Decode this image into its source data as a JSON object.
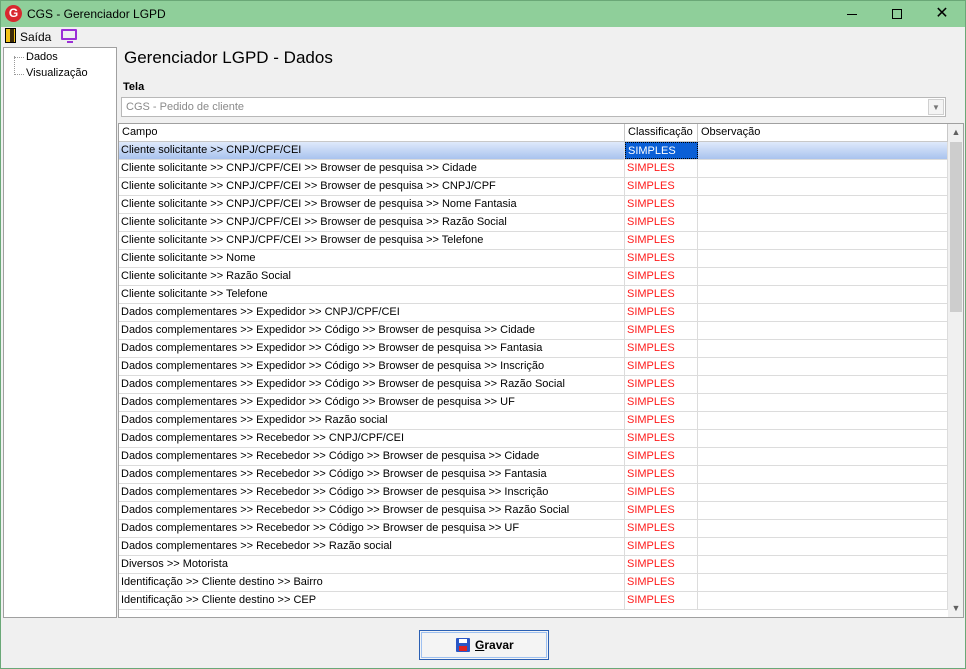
{
  "window": {
    "title": "CGS - Gerenciador LGPD",
    "logo_letter": "G",
    "minimize": "",
    "maximize": "",
    "close": "✕"
  },
  "menu": {
    "exit_label": "Saída"
  },
  "tree": {
    "items": [
      "Dados",
      "Visualização"
    ]
  },
  "page": {
    "title": "Gerenciador LGPD - Dados"
  },
  "tela": {
    "label": "Tela",
    "value": "CGS - Pedido de cliente"
  },
  "grid": {
    "columns": [
      "Campo",
      "Classificação",
      "Observação"
    ],
    "rows": [
      {
        "campo": "Cliente solicitante >> CNPJ/CPF/CEI",
        "classificacao": "SIMPLES",
        "observacao": ""
      },
      {
        "campo": "Cliente solicitante >> CNPJ/CPF/CEI >> Browser de pesquisa >> Cidade",
        "classificacao": "SIMPLES",
        "observacao": ""
      },
      {
        "campo": "Cliente solicitante >> CNPJ/CPF/CEI >> Browser de pesquisa >> CNPJ/CPF",
        "classificacao": "SIMPLES",
        "observacao": ""
      },
      {
        "campo": "Cliente solicitante >> CNPJ/CPF/CEI >> Browser de pesquisa >> Nome Fantasia",
        "classificacao": "SIMPLES",
        "observacao": ""
      },
      {
        "campo": "Cliente solicitante >> CNPJ/CPF/CEI >> Browser de pesquisa >> Razão Social",
        "classificacao": "SIMPLES",
        "observacao": ""
      },
      {
        "campo": "Cliente solicitante >> CNPJ/CPF/CEI >> Browser de pesquisa >> Telefone",
        "classificacao": "SIMPLES",
        "observacao": ""
      },
      {
        "campo": "Cliente solicitante >> Nome",
        "classificacao": "SIMPLES",
        "observacao": ""
      },
      {
        "campo": "Cliente solicitante >> Razão Social",
        "classificacao": "SIMPLES",
        "observacao": ""
      },
      {
        "campo": "Cliente solicitante >> Telefone",
        "classificacao": "SIMPLES",
        "observacao": ""
      },
      {
        "campo": "Dados complementares >> Expedidor >> CNPJ/CPF/CEI",
        "classificacao": "SIMPLES",
        "observacao": ""
      },
      {
        "campo": "Dados complementares >> Expedidor >> Código >> Browser de pesquisa >> Cidade",
        "classificacao": "SIMPLES",
        "observacao": ""
      },
      {
        "campo": "Dados complementares >> Expedidor >> Código >> Browser de pesquisa >> Fantasia",
        "classificacao": "SIMPLES",
        "observacao": ""
      },
      {
        "campo": "Dados complementares >> Expedidor >> Código >> Browser de pesquisa >> Inscrição",
        "classificacao": "SIMPLES",
        "observacao": ""
      },
      {
        "campo": "Dados complementares >> Expedidor >> Código >> Browser de pesquisa >> Razão Social",
        "classificacao": "SIMPLES",
        "observacao": ""
      },
      {
        "campo": "Dados complementares >> Expedidor >> Código >> Browser de pesquisa >> UF",
        "classificacao": "SIMPLES",
        "observacao": ""
      },
      {
        "campo": "Dados complementares >> Expedidor >> Razão social",
        "classificacao": "SIMPLES",
        "observacao": ""
      },
      {
        "campo": "Dados complementares >> Recebedor >> CNPJ/CPF/CEI",
        "classificacao": "SIMPLES",
        "observacao": ""
      },
      {
        "campo": "Dados complementares >> Recebedor >> Código >> Browser de pesquisa >> Cidade",
        "classificacao": "SIMPLES",
        "observacao": ""
      },
      {
        "campo": "Dados complementares >> Recebedor >> Código >> Browser de pesquisa >> Fantasia",
        "classificacao": "SIMPLES",
        "observacao": ""
      },
      {
        "campo": "Dados complementares >> Recebedor >> Código >> Browser de pesquisa >> Inscrição",
        "classificacao": "SIMPLES",
        "observacao": ""
      },
      {
        "campo": "Dados complementares >> Recebedor >> Código >> Browser de pesquisa >> Razão Social",
        "classificacao": "SIMPLES",
        "observacao": ""
      },
      {
        "campo": "Dados complementares >> Recebedor >> Código >> Browser de pesquisa >> UF",
        "classificacao": "SIMPLES",
        "observacao": ""
      },
      {
        "campo": "Dados complementares >> Recebedor >> Razão social",
        "classificacao": "SIMPLES",
        "observacao": ""
      },
      {
        "campo": "Diversos >> Motorista",
        "classificacao": "SIMPLES",
        "observacao": ""
      },
      {
        "campo": "Identificação  >> Cliente destino >>  Bairro",
        "classificacao": "SIMPLES",
        "observacao": ""
      },
      {
        "campo": "Identificação  >> Cliente destino >> CEP",
        "classificacao": "SIMPLES",
        "observacao": ""
      }
    ],
    "selected_row": 0
  },
  "actions": {
    "save_label": "Gravar",
    "save_accel": "G",
    "save_rest": "ravar"
  },
  "colors": {
    "titlebar": "#8fcf9a",
    "classification_text": "#ff1a1a",
    "selection": "#0a5fd6"
  },
  "icons": {
    "app": "cgs-logo-icon",
    "exit": "exit-door-icon",
    "monitor": "monitor-icon",
    "save": "floppy-disk-icon"
  }
}
